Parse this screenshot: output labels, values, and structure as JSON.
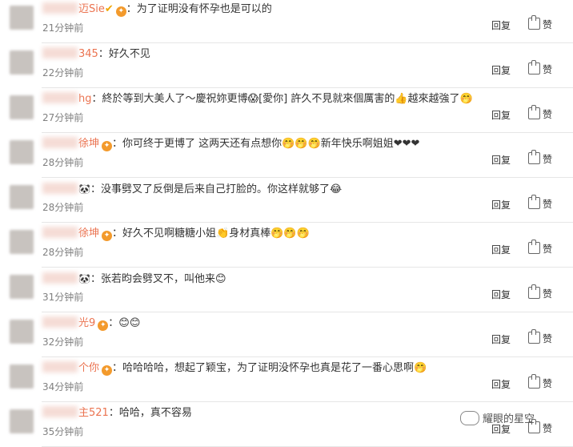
{
  "comments": [
    {
      "user": "迈Sie",
      "badge": "vip",
      "text": "为了证明没有怀孕也是可以的",
      "time": "21分钟前"
    },
    {
      "user": "345",
      "badge": "",
      "text": "好久不见",
      "time": "22分钟前"
    },
    {
      "user": "hg",
      "badge": "",
      "text": "終於等到大美人了～慶祝妳更博😱[愛你] 許久不見就來個厲害的👍越來越強了🤭",
      "time": "27分钟前"
    },
    {
      "user": "徐坤",
      "badge": "medal",
      "text": "你可终于更博了 这两天还有点想你🤭🤭🤭新年快乐啊姐姐❤❤❤",
      "time": "28分钟前"
    },
    {
      "user": "",
      "badge": "panda",
      "text": "没事劈叉了反倒是后来自己打脸的。你这样就够了😂",
      "time": "28分钟前"
    },
    {
      "user": "徐坤",
      "badge": "medal",
      "text": "好久不见啊糖糖小姐👏身材真棒🤭🤭🤭",
      "time": "28分钟前"
    },
    {
      "user": "",
      "badge": "panda",
      "text": "张若昀会劈叉不，叫他来😊",
      "time": "31分钟前"
    },
    {
      "user": "光9",
      "badge": "medal",
      "text": "😊😊",
      "time": "32分钟前"
    },
    {
      "user": "个你",
      "badge": "medal",
      "text": "哈哈哈哈，想起了颖宝，为了证明没怀孕也真是花了一番心思啊🤭",
      "time": "34分钟前"
    },
    {
      "user": "主521",
      "badge": "",
      "text": "哈哈，真不容易",
      "time": "35分钟前"
    }
  ],
  "actions": {
    "reply": "回复",
    "like": "赞"
  },
  "watermark": "耀眼的星空"
}
